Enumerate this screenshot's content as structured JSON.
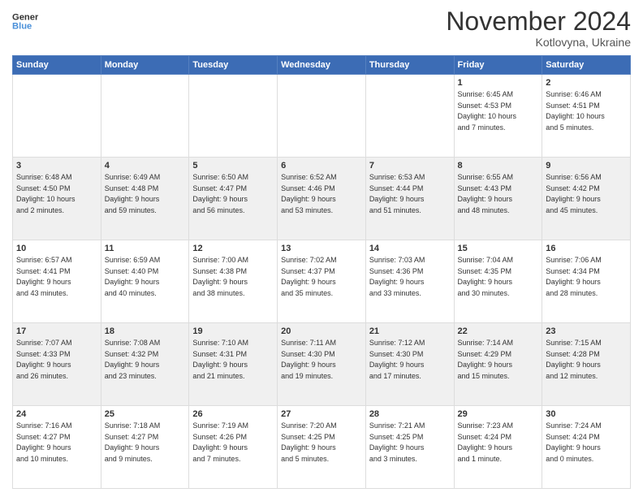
{
  "logo": {
    "line1": "General",
    "line2": "Blue"
  },
  "title": "November 2024",
  "subtitle": "Kotlovyna, Ukraine",
  "days_header": [
    "Sunday",
    "Monday",
    "Tuesday",
    "Wednesday",
    "Thursday",
    "Friday",
    "Saturday"
  ],
  "weeks": [
    [
      {
        "day": "",
        "info": ""
      },
      {
        "day": "",
        "info": ""
      },
      {
        "day": "",
        "info": ""
      },
      {
        "day": "",
        "info": ""
      },
      {
        "day": "",
        "info": ""
      },
      {
        "day": "1",
        "info": "Sunrise: 6:45 AM\nSunset: 4:53 PM\nDaylight: 10 hours\nand 7 minutes."
      },
      {
        "day": "2",
        "info": "Sunrise: 6:46 AM\nSunset: 4:51 PM\nDaylight: 10 hours\nand 5 minutes."
      }
    ],
    [
      {
        "day": "3",
        "info": "Sunrise: 6:48 AM\nSunset: 4:50 PM\nDaylight: 10 hours\nand 2 minutes."
      },
      {
        "day": "4",
        "info": "Sunrise: 6:49 AM\nSunset: 4:48 PM\nDaylight: 9 hours\nand 59 minutes."
      },
      {
        "day": "5",
        "info": "Sunrise: 6:50 AM\nSunset: 4:47 PM\nDaylight: 9 hours\nand 56 minutes."
      },
      {
        "day": "6",
        "info": "Sunrise: 6:52 AM\nSunset: 4:46 PM\nDaylight: 9 hours\nand 53 minutes."
      },
      {
        "day": "7",
        "info": "Sunrise: 6:53 AM\nSunset: 4:44 PM\nDaylight: 9 hours\nand 51 minutes."
      },
      {
        "day": "8",
        "info": "Sunrise: 6:55 AM\nSunset: 4:43 PM\nDaylight: 9 hours\nand 48 minutes."
      },
      {
        "day": "9",
        "info": "Sunrise: 6:56 AM\nSunset: 4:42 PM\nDaylight: 9 hours\nand 45 minutes."
      }
    ],
    [
      {
        "day": "10",
        "info": "Sunrise: 6:57 AM\nSunset: 4:41 PM\nDaylight: 9 hours\nand 43 minutes."
      },
      {
        "day": "11",
        "info": "Sunrise: 6:59 AM\nSunset: 4:40 PM\nDaylight: 9 hours\nand 40 minutes."
      },
      {
        "day": "12",
        "info": "Sunrise: 7:00 AM\nSunset: 4:38 PM\nDaylight: 9 hours\nand 38 minutes."
      },
      {
        "day": "13",
        "info": "Sunrise: 7:02 AM\nSunset: 4:37 PM\nDaylight: 9 hours\nand 35 minutes."
      },
      {
        "day": "14",
        "info": "Sunrise: 7:03 AM\nSunset: 4:36 PM\nDaylight: 9 hours\nand 33 minutes."
      },
      {
        "day": "15",
        "info": "Sunrise: 7:04 AM\nSunset: 4:35 PM\nDaylight: 9 hours\nand 30 minutes."
      },
      {
        "day": "16",
        "info": "Sunrise: 7:06 AM\nSunset: 4:34 PM\nDaylight: 9 hours\nand 28 minutes."
      }
    ],
    [
      {
        "day": "17",
        "info": "Sunrise: 7:07 AM\nSunset: 4:33 PM\nDaylight: 9 hours\nand 26 minutes."
      },
      {
        "day": "18",
        "info": "Sunrise: 7:08 AM\nSunset: 4:32 PM\nDaylight: 9 hours\nand 23 minutes."
      },
      {
        "day": "19",
        "info": "Sunrise: 7:10 AM\nSunset: 4:31 PM\nDaylight: 9 hours\nand 21 minutes."
      },
      {
        "day": "20",
        "info": "Sunrise: 7:11 AM\nSunset: 4:30 PM\nDaylight: 9 hours\nand 19 minutes."
      },
      {
        "day": "21",
        "info": "Sunrise: 7:12 AM\nSunset: 4:30 PM\nDaylight: 9 hours\nand 17 minutes."
      },
      {
        "day": "22",
        "info": "Sunrise: 7:14 AM\nSunset: 4:29 PM\nDaylight: 9 hours\nand 15 minutes."
      },
      {
        "day": "23",
        "info": "Sunrise: 7:15 AM\nSunset: 4:28 PM\nDaylight: 9 hours\nand 12 minutes."
      }
    ],
    [
      {
        "day": "24",
        "info": "Sunrise: 7:16 AM\nSunset: 4:27 PM\nDaylight: 9 hours\nand 10 minutes."
      },
      {
        "day": "25",
        "info": "Sunrise: 7:18 AM\nSunset: 4:27 PM\nDaylight: 9 hours\nand 9 minutes."
      },
      {
        "day": "26",
        "info": "Sunrise: 7:19 AM\nSunset: 4:26 PM\nDaylight: 9 hours\nand 7 minutes."
      },
      {
        "day": "27",
        "info": "Sunrise: 7:20 AM\nSunset: 4:25 PM\nDaylight: 9 hours\nand 5 minutes."
      },
      {
        "day": "28",
        "info": "Sunrise: 7:21 AM\nSunset: 4:25 PM\nDaylight: 9 hours\nand 3 minutes."
      },
      {
        "day": "29",
        "info": "Sunrise: 7:23 AM\nSunset: 4:24 PM\nDaylight: 9 hours\nand 1 minute."
      },
      {
        "day": "30",
        "info": "Sunrise: 7:24 AM\nSunset: 4:24 PM\nDaylight: 9 hours\nand 0 minutes."
      }
    ]
  ]
}
